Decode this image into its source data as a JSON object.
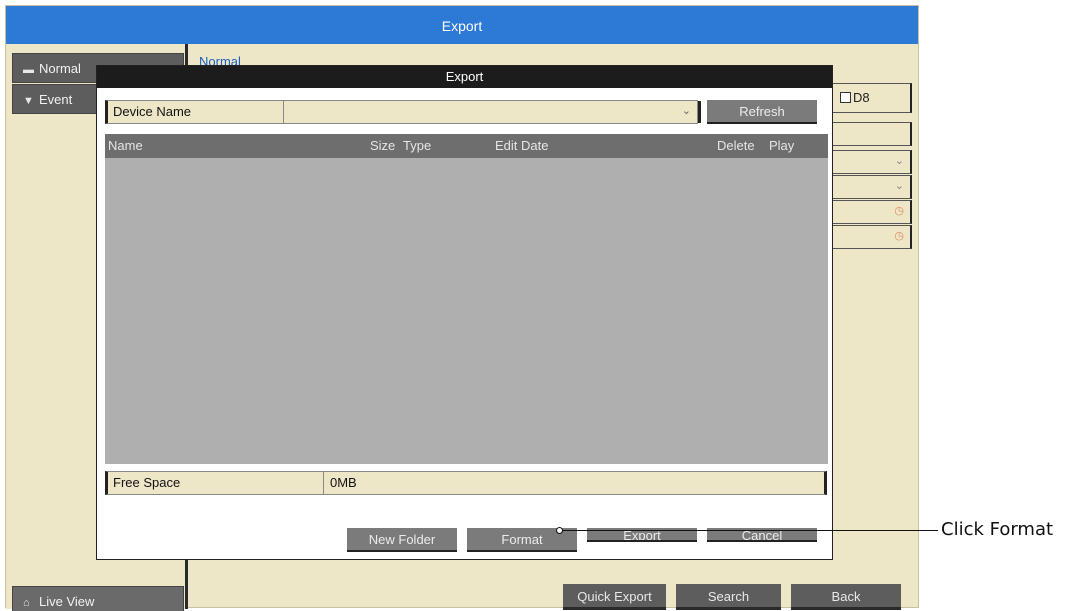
{
  "window": {
    "title": "Export"
  },
  "sidebar": {
    "items": [
      {
        "label": "Normal",
        "icon": "folder-icon"
      },
      {
        "label": "Event",
        "icon": "event-icon"
      }
    ],
    "live_view": {
      "label": "Live View",
      "icon": "home-icon"
    }
  },
  "content": {
    "tab_label": "Normal",
    "channel_label": "D8"
  },
  "bottom_buttons": {
    "quick_export": "Quick Export",
    "search": "Search",
    "back": "Back"
  },
  "dialog": {
    "title": "Export",
    "device": {
      "label": "Device Name",
      "value": "",
      "refresh": "Refresh"
    },
    "table": {
      "columns": [
        "Name",
        "Size",
        "Type",
        "Edit Date",
        "Delete",
        "Play"
      ],
      "rows": []
    },
    "free_space": {
      "label": "Free Space",
      "value": "0MB"
    },
    "buttons": {
      "new_folder": "New Folder",
      "format": "Format",
      "export": "Export",
      "cancel": "Cancel"
    }
  },
  "callout": {
    "text": "Click Format"
  },
  "colors": {
    "title_bar": "#2c7ad6",
    "panel": "#ede6c7",
    "button": "#7b7b7b",
    "list_bg": "#afafaf",
    "list_header": "#6e6e6e",
    "dialog_title": "#1c1c1c"
  }
}
